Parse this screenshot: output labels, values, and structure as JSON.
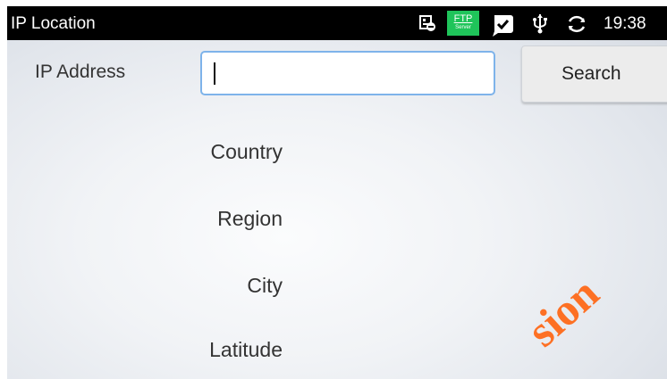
{
  "status_bar": {
    "app_title": "IP Location",
    "ftp_badge": {
      "line1": "FTP",
      "line2": "Server"
    },
    "time": "19:38",
    "icons": [
      "contact-card-icon",
      "ftp-server-icon",
      "check-badge-icon",
      "usb-icon",
      "sync-icon"
    ]
  },
  "form": {
    "ip_label": "IP Address",
    "ip_value": "",
    "search_label": "Search"
  },
  "fields": [
    {
      "label": "Country"
    },
    {
      "label": "Region"
    },
    {
      "label": "City"
    },
    {
      "label": "Latitude"
    }
  ],
  "watermark": "sion",
  "colors": {
    "statusbar": "#000000",
    "ftp_badge": "#1fc45a",
    "input_border": "#7eb3ea",
    "watermark": "#ff6a1a"
  }
}
